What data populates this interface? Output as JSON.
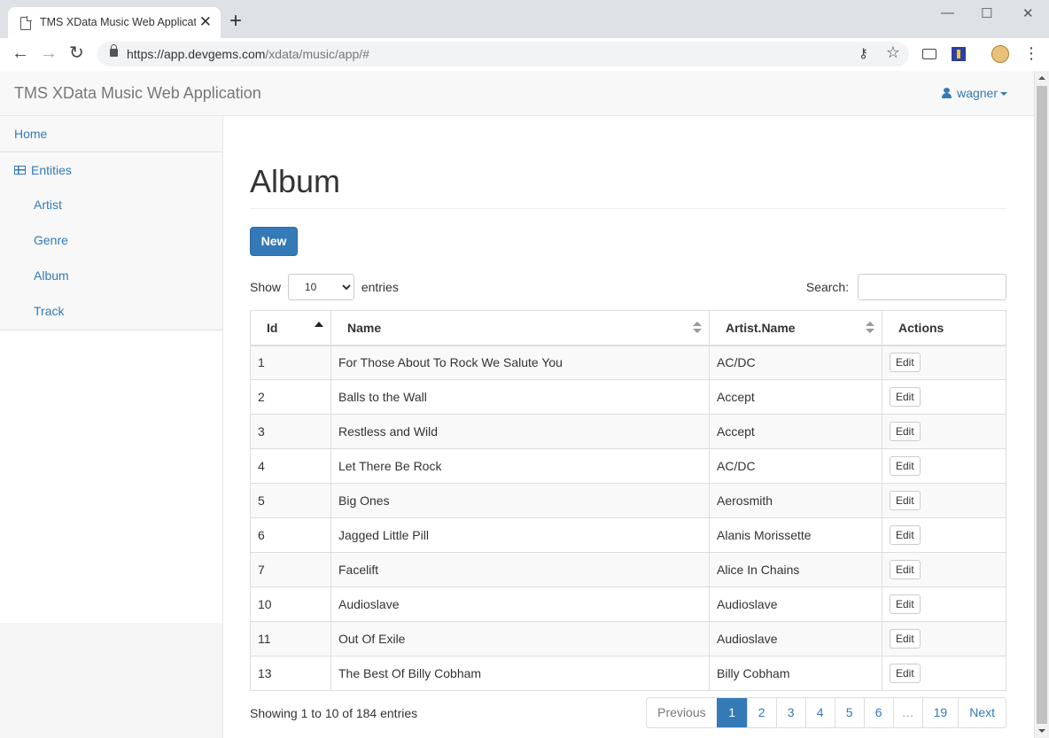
{
  "browser": {
    "tab_title": "TMS XData Music Web Application",
    "tab_close": "✕",
    "new_tab": "+",
    "url_host": "https://app.devgems.com",
    "url_path": "/xdata/music/app/#",
    "window_controls": {
      "minimize": "—",
      "maximize": "☐",
      "close": "✕"
    }
  },
  "navbar": {
    "brand": "TMS XData Music Web Application",
    "user": "wagner"
  },
  "sidebar": {
    "home": "Home",
    "entities": "Entities",
    "items": [
      {
        "label": "Artist"
      },
      {
        "label": "Genre"
      },
      {
        "label": "Album"
      },
      {
        "label": "Track"
      }
    ]
  },
  "main": {
    "title": "Album",
    "new_button": "New",
    "length": {
      "show": "Show",
      "value": "10",
      "entries": "entries"
    },
    "search_label": "Search:",
    "search_value": "",
    "columns": [
      "Id",
      "Name",
      "Artist.Name",
      "Actions"
    ],
    "rows": [
      {
        "id": "1",
        "name": "For Those About To Rock We Salute You",
        "artist": "AC/DC",
        "action": "Edit"
      },
      {
        "id": "2",
        "name": "Balls to the Wall",
        "artist": "Accept",
        "action": "Edit"
      },
      {
        "id": "3",
        "name": "Restless and Wild",
        "artist": "Accept",
        "action": "Edit"
      },
      {
        "id": "4",
        "name": "Let There Be Rock",
        "artist": "AC/DC",
        "action": "Edit"
      },
      {
        "id": "5",
        "name": "Big Ones",
        "artist": "Aerosmith",
        "action": "Edit"
      },
      {
        "id": "6",
        "name": "Jagged Little Pill",
        "artist": "Alanis Morissette",
        "action": "Edit"
      },
      {
        "id": "7",
        "name": "Facelift",
        "artist": "Alice In Chains",
        "action": "Edit"
      },
      {
        "id": "10",
        "name": "Audioslave",
        "artist": "Audioslave",
        "action": "Edit"
      },
      {
        "id": "11",
        "name": "Out Of Exile",
        "artist": "Audioslave",
        "action": "Edit"
      },
      {
        "id": "13",
        "name": "The Best Of Billy Cobham",
        "artist": "Billy Cobham",
        "action": "Edit"
      }
    ],
    "info": "Showing 1 to 10 of 184 entries",
    "pagination": {
      "previous": "Previous",
      "pages": [
        "1",
        "2",
        "3",
        "4",
        "5",
        "6"
      ],
      "ellipsis": "…",
      "last": "19",
      "next": "Next",
      "current": "1"
    }
  },
  "colors": {
    "primary": "#337ab7",
    "navbar_bg": "#f8f8f8",
    "chrome_bg": "#dee1e6"
  }
}
